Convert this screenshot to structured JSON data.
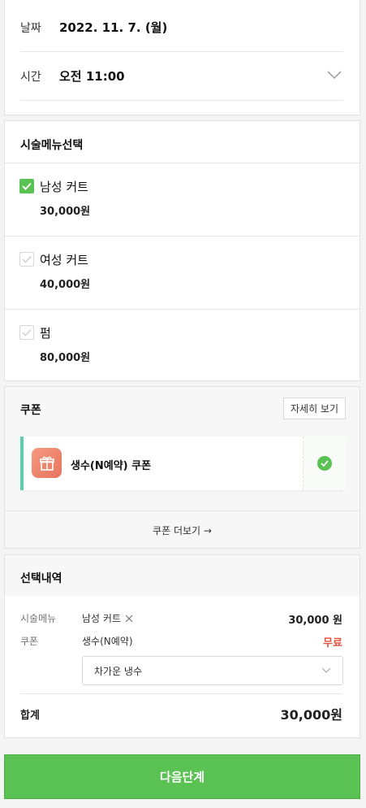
{
  "datetime": {
    "date_label": "날짜",
    "date_value": "2022. 11. 7. (월)",
    "time_label": "시간",
    "time_value": "오전 11:00"
  },
  "menu": {
    "title": "시술메뉴선택",
    "items": [
      {
        "name": "남성 커트",
        "price": "30,000원",
        "checked": true
      },
      {
        "name": "여성 커트",
        "price": "40,000원",
        "checked": false
      },
      {
        "name": "펌",
        "price": "80,000원",
        "checked": false
      }
    ]
  },
  "coupon": {
    "title": "쿠폰",
    "detail_label": "자세히 보기",
    "item_name": "생수(N예약) 쿠폰",
    "more_label": "쿠폰 더보기 →",
    "accent_color": "#5ccfae"
  },
  "summary": {
    "title": "선택내역",
    "menu_label": "시술메뉴",
    "menu_value": "남성 커트",
    "menu_amount": "30,000 원",
    "coupon_label": "쿠폰",
    "coupon_value": "생수(N예약)",
    "coupon_amount": "무료",
    "coupon_amount_color": "#e0513f",
    "select_value": "차가운 냉수",
    "total_label": "합계",
    "total_amount": "30,000원"
  },
  "next_button": "다음단계",
  "brand_color": "#5ac153"
}
